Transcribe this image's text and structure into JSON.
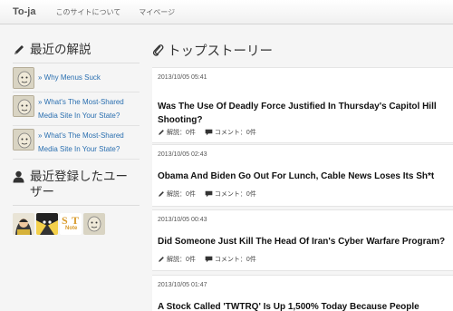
{
  "nav": {
    "brand": "To-ja",
    "links": [
      "このサイトについて",
      "マイページ"
    ]
  },
  "sidebar": {
    "recent_comments_heading": "最近の解説",
    "recent_comments": [
      "» Why Menus Suck",
      "» What's The Most-Shared Media Site In Your State?",
      "» What's The Most-Shared Media Site In Your State?"
    ],
    "recent_users_heading": "最近登録したユーザー",
    "user_badge": [
      "S",
      "T",
      "Note"
    ]
  },
  "main": {
    "heading": "トップストーリー",
    "stories": [
      {
        "date": "2013/10/05 05:41",
        "title": "Was The Use Of Deadly Force Justified In Thursday's Capitol Hill Shooting?",
        "comments_label": "解説：0件",
        "discussion_label": "コメント：0件"
      },
      {
        "date": "2013/10/05 02:43",
        "title": "Obama And Biden Go Out For Lunch, Cable News Loses Its Sh*t",
        "comments_label": "解説：0件",
        "discussion_label": "コメント：0件"
      },
      {
        "date": "2013/10/05 00:43",
        "title": "Did Someone Just Kill The Head Of Iran's Cyber Warfare Program?",
        "comments_label": "解説：0件",
        "discussion_label": "コメント：0件"
      },
      {
        "date": "2013/10/05 01:47",
        "title": "A Stock Called 'TWTRQ' Is Up 1,500% Today Because People",
        "comments_label": "",
        "discussion_label": ""
      }
    ]
  },
  "colors": {
    "link": "#2a6fb0",
    "background": "#f5f5f5",
    "card": "#ffffff"
  }
}
